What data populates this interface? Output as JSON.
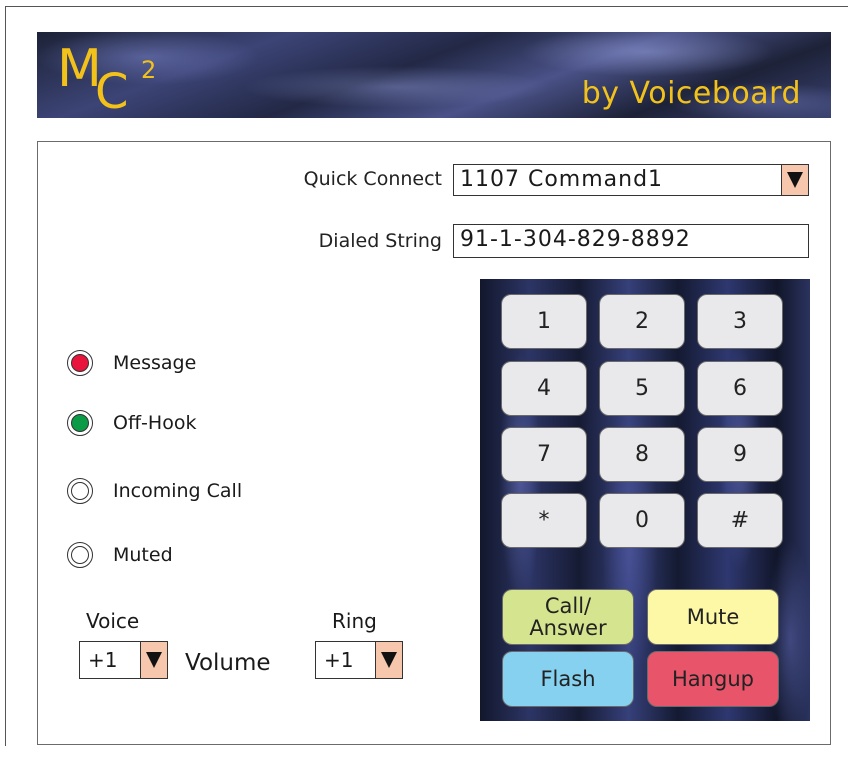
{
  "banner": {
    "logo_text": "MC2",
    "byline": "by Voiceboard",
    "accent_color": "#f2c21b"
  },
  "quick_connect": {
    "label": "Quick Connect",
    "value": "1107  Command1"
  },
  "dialed_string": {
    "label": "Dialed String",
    "value": "91-1-304-829-8892"
  },
  "indicators": [
    {
      "label": "Message",
      "color": "#e8143c",
      "state": "on"
    },
    {
      "label": "Off-Hook",
      "color": "#0b9a45",
      "state": "on"
    },
    {
      "label": "Incoming Call",
      "color": "#ffffff",
      "state": "off"
    },
    {
      "label": "Muted",
      "color": "#ffffff",
      "state": "off"
    }
  ],
  "volume": {
    "label": "Volume",
    "voice": {
      "caption": "Voice",
      "value": "+1"
    },
    "ring": {
      "caption": "Ring",
      "value": "+1"
    }
  },
  "keypad": {
    "keys": [
      "1",
      "2",
      "3",
      "4",
      "5",
      "6",
      "7",
      "8",
      "9",
      "*",
      "0",
      "#"
    ],
    "call_answer": {
      "label": "Call/\nAnswer",
      "color": "#d5e48e"
    },
    "mute": {
      "label": "Mute",
      "color": "#fcf8a6"
    },
    "flash": {
      "label": "Flash",
      "color": "#86d1ef"
    },
    "hangup": {
      "label": "Hangup",
      "color": "#e8556a"
    }
  }
}
